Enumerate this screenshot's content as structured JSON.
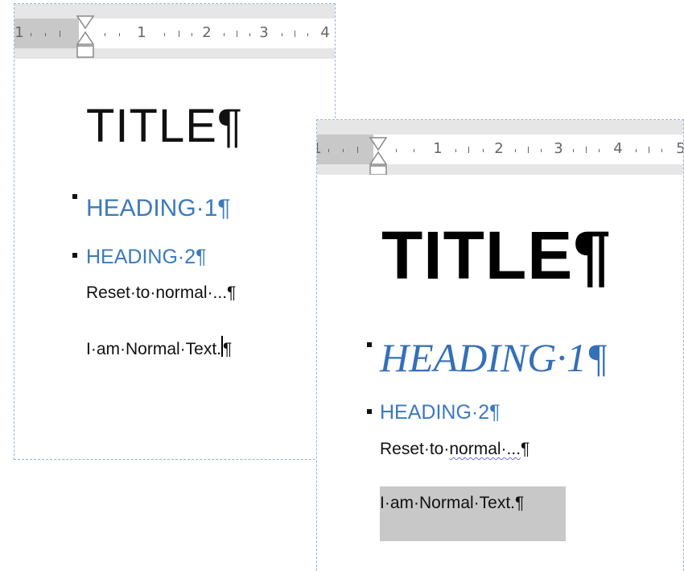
{
  "left_page": {
    "ruler_numbers": [
      "1",
      "1",
      "2",
      "3",
      "4"
    ],
    "title": "TITLE¶",
    "heading1": "HEADING·1¶",
    "heading2": "HEADING·2¶",
    "reset_line": "Reset·to·normal·...¶",
    "normal_text_before_cursor": "I·am·Normal·Text.",
    "normal_text_after_cursor": "¶"
  },
  "right_page": {
    "ruler_numbers": [
      "1",
      "1",
      "2",
      "3",
      "4",
      "5"
    ],
    "title": "TITLE¶",
    "heading1": "HEADING·1¶",
    "heading2": "HEADING·2¶",
    "reset_line_pre": "Reset·to·",
    "reset_line_squiggle": "normal·...",
    "reset_line_post": "¶",
    "normal_text": "I·am·Normal·Text.¶"
  },
  "colors": {
    "heading_blue": "#3c7abd",
    "ruler_gray": "#e6e6e6",
    "selection_gray": "#c8c8c8",
    "page_border": "#9bb3cf"
  },
  "icons": [
    "indent-marker-icon",
    "bullet-icon"
  ]
}
